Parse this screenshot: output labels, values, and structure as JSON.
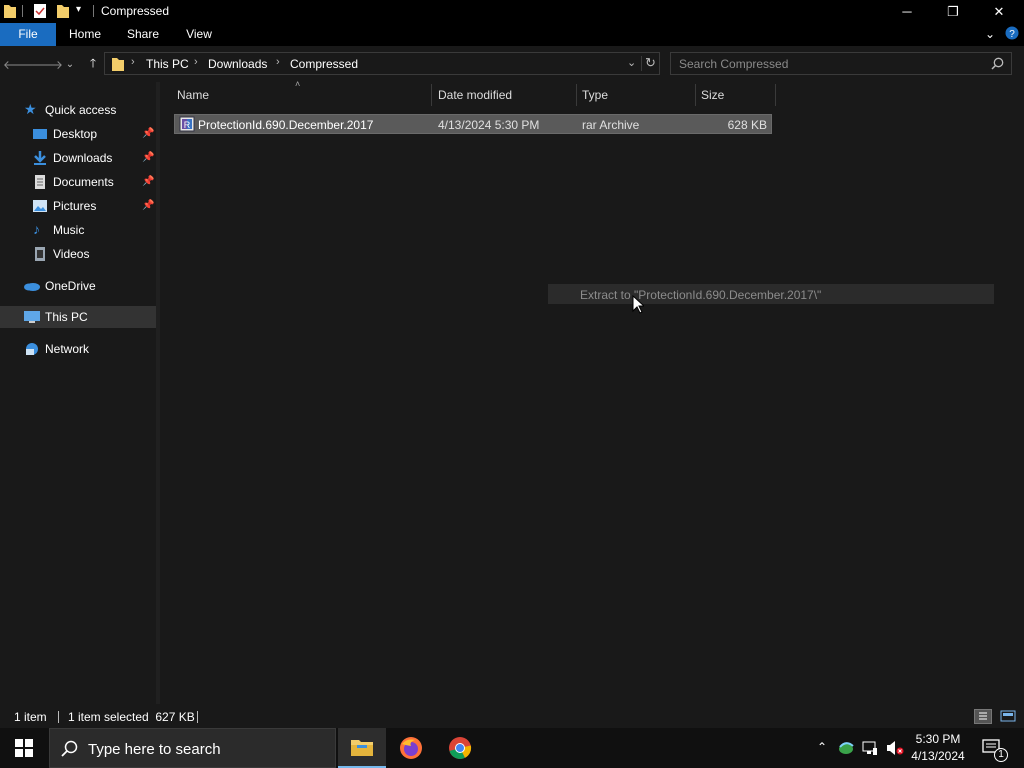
{
  "window": {
    "title": "Compressed",
    "minimize_label": "─",
    "restore_label": "❐",
    "close_label": "✕"
  },
  "ribbon": {
    "tabs": [
      {
        "label": "File"
      },
      {
        "label": "Home"
      },
      {
        "label": "Share"
      },
      {
        "label": "View"
      }
    ]
  },
  "address": {
    "crumbs": [
      "This PC",
      "Downloads",
      "Compressed"
    ],
    "search_placeholder": "Search Compressed"
  },
  "nav": {
    "items": [
      {
        "label": "Quick access",
        "icon": "star-icon"
      },
      {
        "label": "Desktop",
        "icon": "desktop-icon",
        "pinned": true
      },
      {
        "label": "Downloads",
        "icon": "download-icon",
        "pinned": true
      },
      {
        "label": "Documents",
        "icon": "documents-icon",
        "pinned": true
      },
      {
        "label": "Pictures",
        "icon": "pictures-icon",
        "pinned": true
      },
      {
        "label": "Music",
        "icon": "music-icon"
      },
      {
        "label": "Videos",
        "icon": "videos-icon"
      },
      {
        "label": "OneDrive",
        "icon": "cloud-icon"
      },
      {
        "label": "This PC",
        "icon": "computer-icon",
        "selected": true
      },
      {
        "label": "Network",
        "icon": "network-icon"
      }
    ]
  },
  "columns": {
    "name": "Name",
    "date": "Date modified",
    "type": "Type",
    "size": "Size"
  },
  "files": [
    {
      "name": "ProtectionId.690.December.2017",
      "date": "4/13/2024 5:30 PM",
      "type": "rar Archive",
      "size": "628 KB",
      "selected": true
    }
  ],
  "drag_tooltip": "Extract to \"ProtectionId.690.December.2017\\\"",
  "status": {
    "count": "1 item",
    "selected": "1 item selected  627 KB"
  },
  "taskbar": {
    "search_placeholder": "Type here to search",
    "time": "5:30 PM",
    "date": "4/13/2024",
    "notification_count": "1"
  },
  "colors": {
    "accent": "#1a6cc0",
    "selection": "#5a5a5a",
    "background": "#191919"
  }
}
